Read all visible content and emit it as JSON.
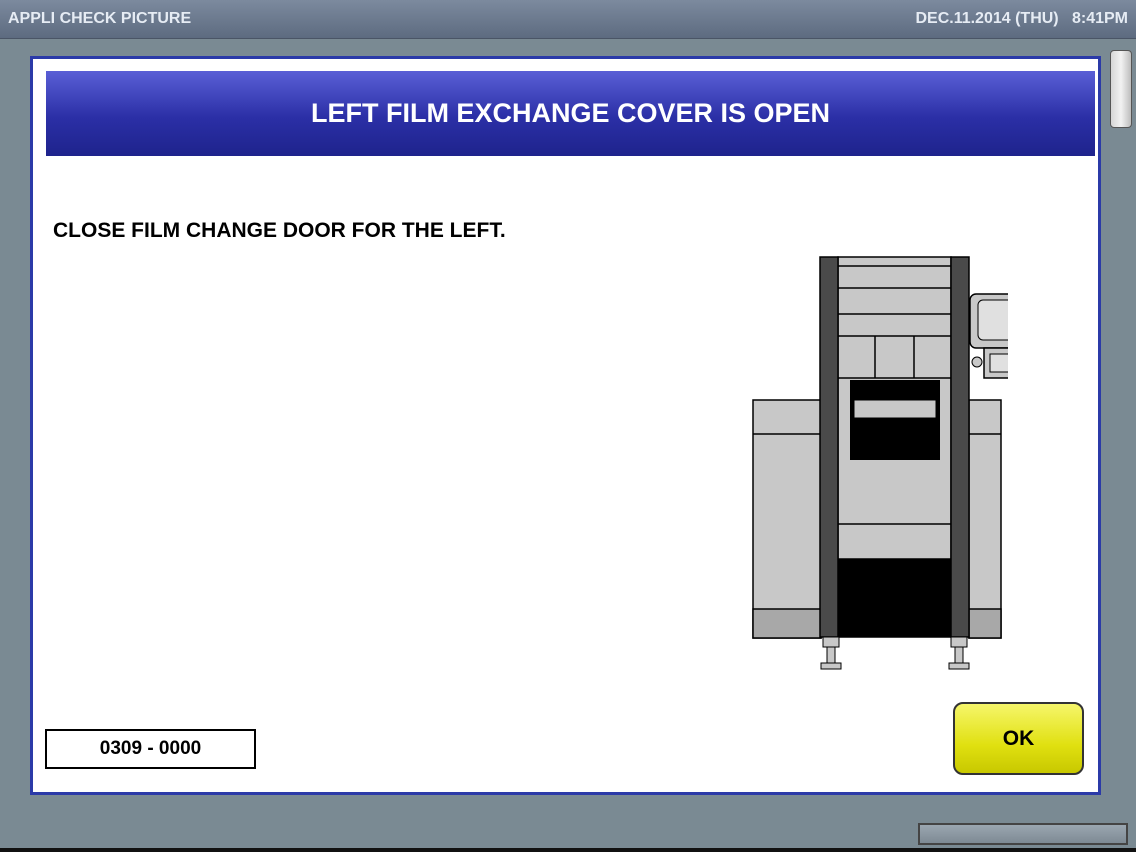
{
  "header": {
    "title": "APPLI CHECK PICTURE",
    "datetime": "DEC.11.2014 (THU)   8:41PM"
  },
  "dialog": {
    "title": "LEFT FILM EXCHANGE COVER IS OPEN",
    "message": "CLOSE FILM CHANGE DOOR FOR THE LEFT.",
    "error_code": "0309 - 0000",
    "ok_label": "OK",
    "illustration": "packaging-machine-front-view"
  },
  "colors": {
    "header_blue": "#2b2fa6",
    "ok_yellow": "#e0e010",
    "background": "#7a8a93"
  }
}
